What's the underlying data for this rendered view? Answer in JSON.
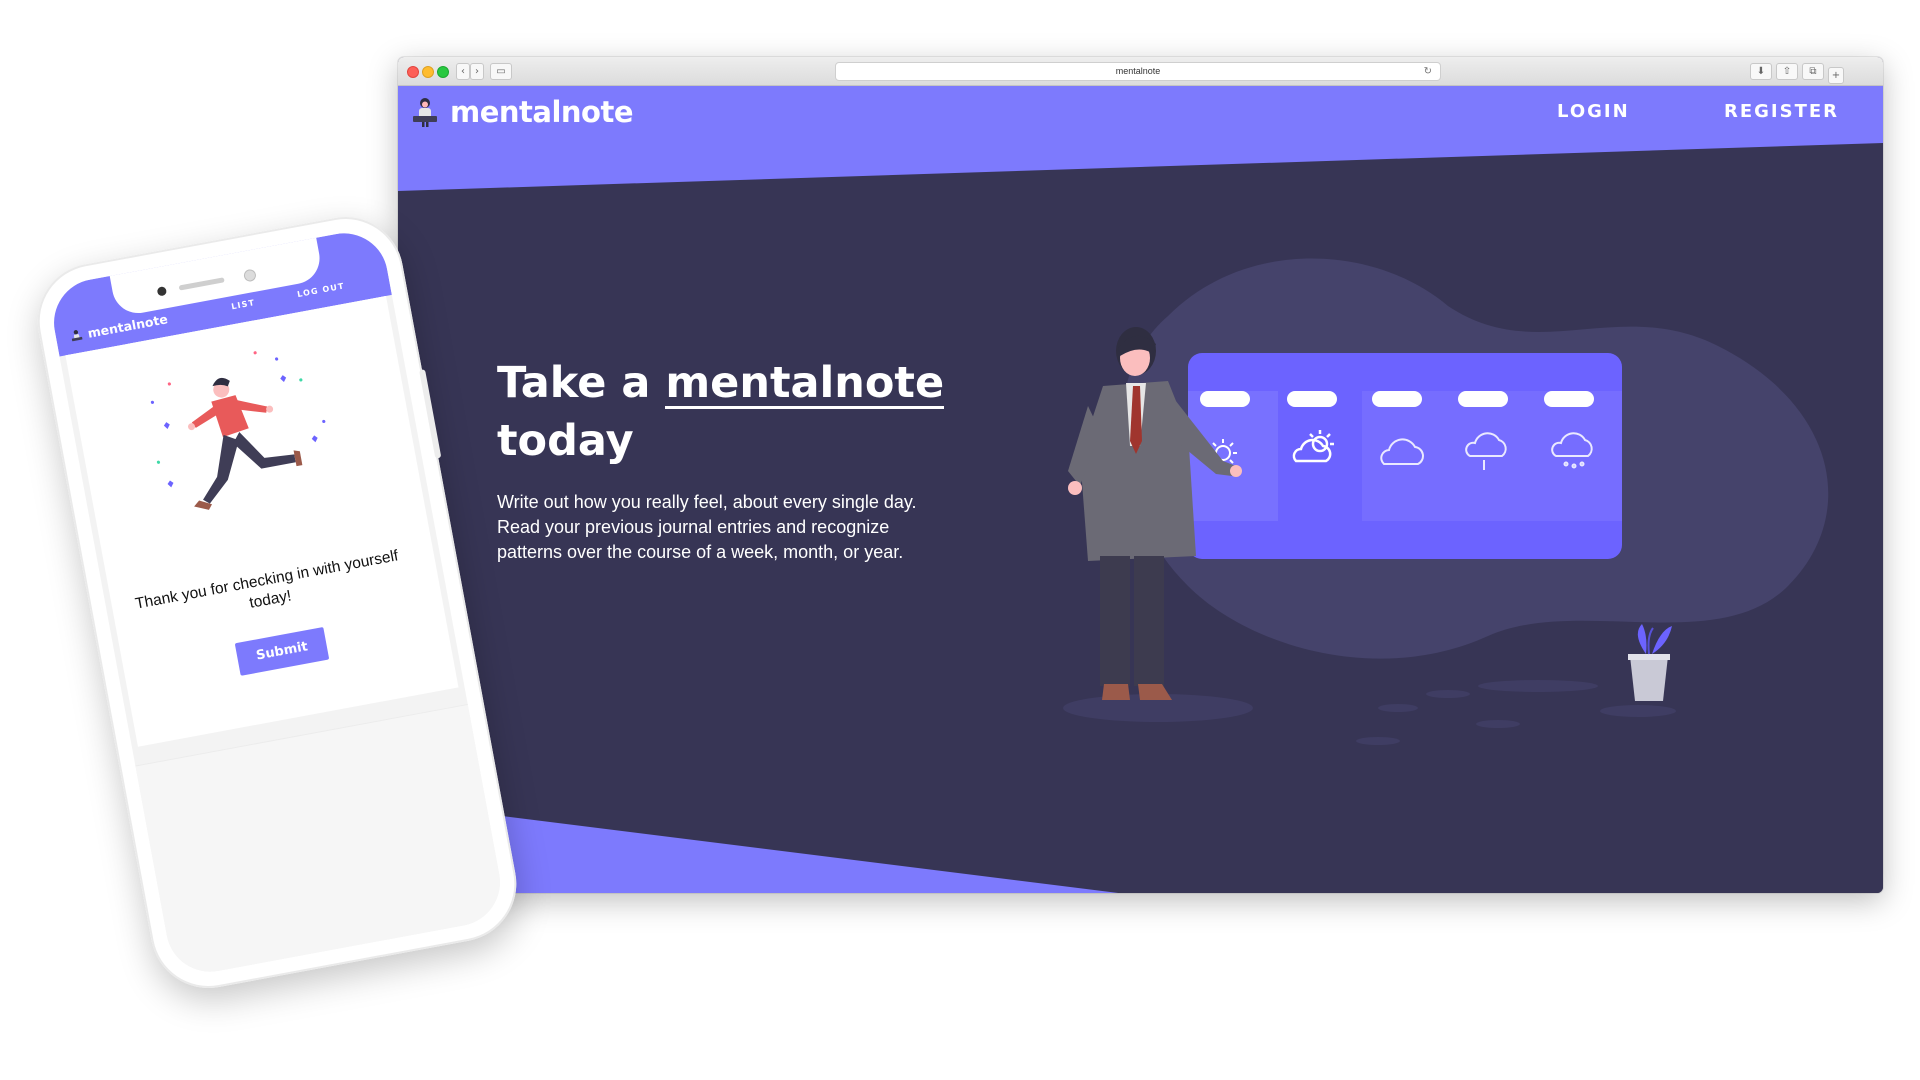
{
  "browser": {
    "url": "mentalnote",
    "buttons": {
      "back": "‹",
      "forward": "›",
      "sidebar": "▭",
      "reload": "↻",
      "download": "⬇",
      "share": "⇧",
      "tabs": "⧉",
      "new_tab": "+"
    }
  },
  "site": {
    "logo_text": "mentalnote",
    "nav": {
      "login": "LOGIN",
      "register": "REGISTER"
    },
    "hero": {
      "title_prefix": "Take a ",
      "title_highlight": "mentalnote",
      "title_suffix": "today",
      "description": "Write out how you really feel, about every single day. Read your previous journal entries and recognize patterns over the course of a week, month, or year."
    }
  },
  "phone": {
    "logo_text": "mentalnote",
    "nav": {
      "list": "LIST",
      "logout": "LOG OUT"
    },
    "thanks_text": "Thank you for checking in with yourself today!",
    "submit_label": "Submit"
  },
  "colors": {
    "accent": "#7d7afd",
    "dark_bg": "#373555",
    "white": "#ffffff"
  }
}
